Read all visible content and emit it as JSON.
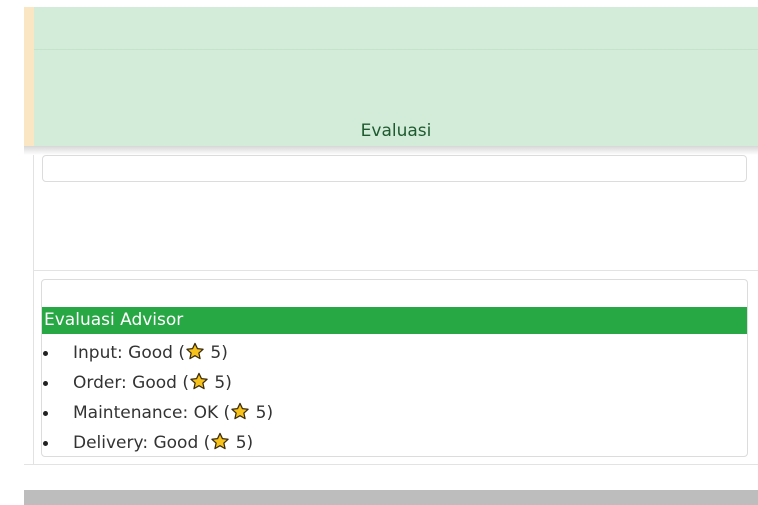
{
  "header": {
    "title": "Evaluasi"
  },
  "card": {
    "title": "Evaluasi Advisor",
    "items": [
      {
        "label": "Input",
        "rating": "Good",
        "score": "5"
      },
      {
        "label": "Order",
        "rating": "Good",
        "score": "5"
      },
      {
        "label": "Maintenance",
        "rating": "OK",
        "score": "5"
      },
      {
        "label": "Delivery",
        "rating": "Good",
        "score": "5"
      }
    ]
  },
  "colors": {
    "header_bg": "#d3ecd9",
    "header_text": "#1e5a2f",
    "card_header_bg": "#28a745",
    "strip": "#fbe6c3",
    "star": "#f7c31a"
  },
  "icons": {
    "rating": "star-icon"
  }
}
